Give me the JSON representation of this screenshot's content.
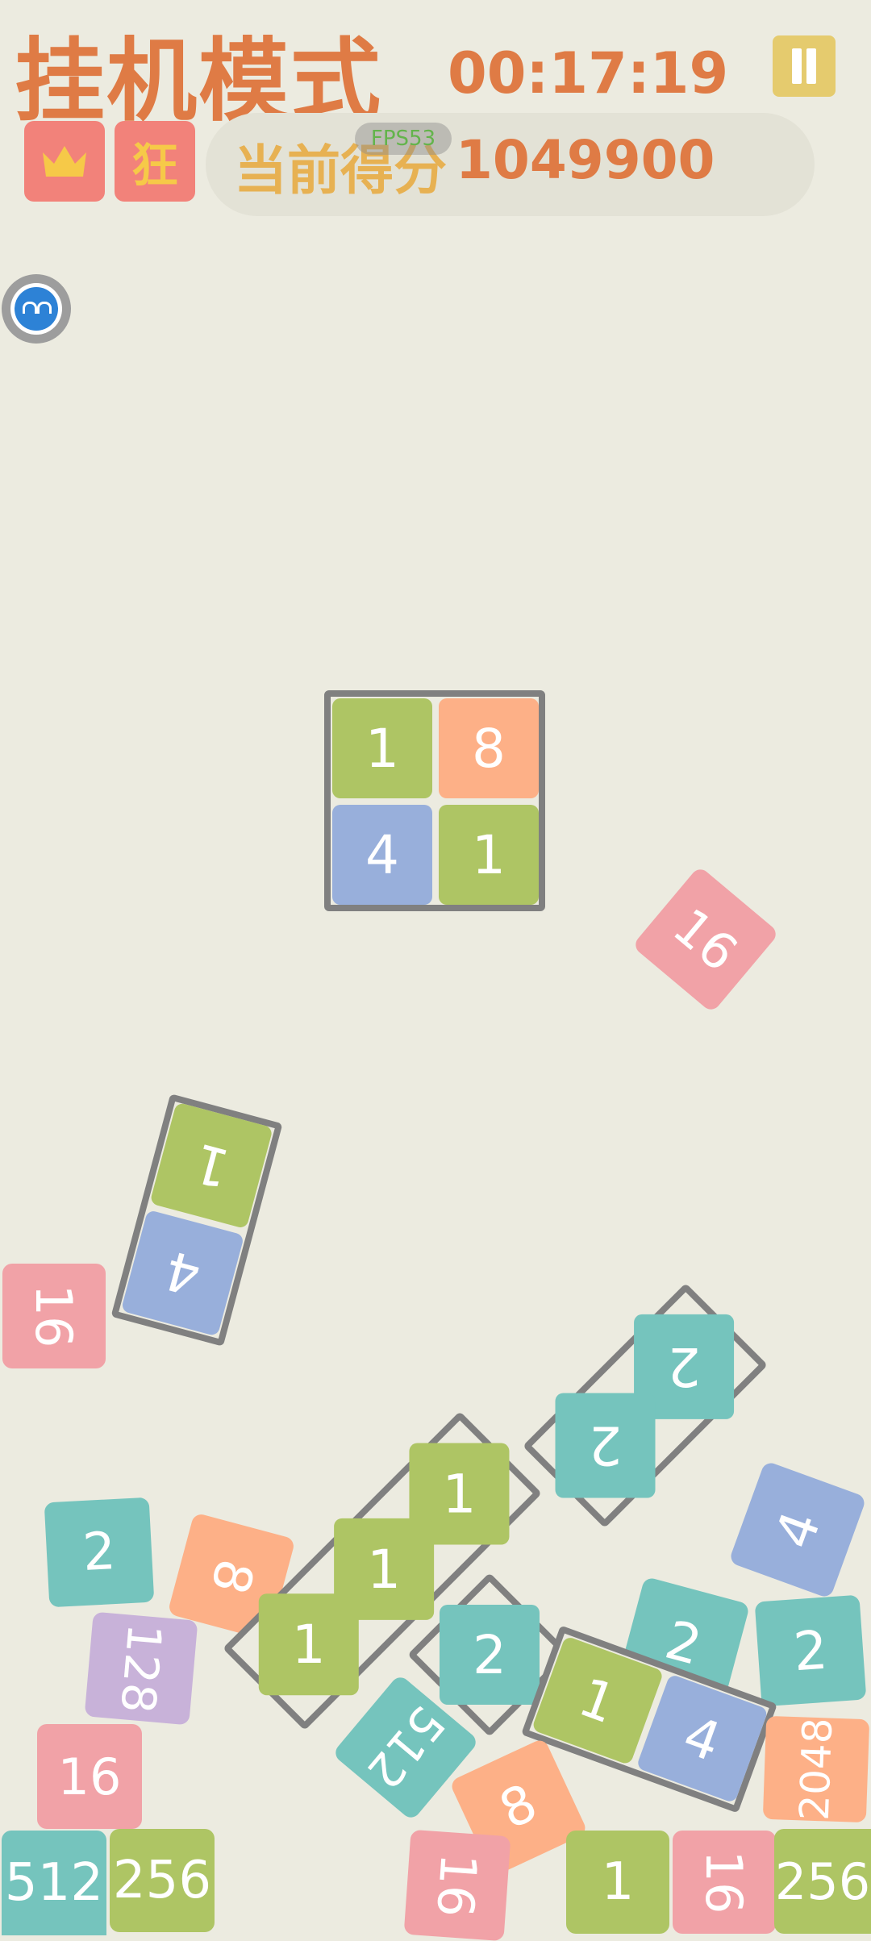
{
  "header": {
    "mode_title": "挂机模式",
    "timer": "00:17:19",
    "pause_icon": "pause-icon",
    "crown_icon": "crown-icon",
    "crazy_label": "狂",
    "score_label": "当前得分",
    "score_value": "1049900",
    "fps_label": "FPS53"
  },
  "assistant_icon": "bot-face-icon",
  "colors": {
    "background": "#ecebe0",
    "title": "#df7b45",
    "tile_1": "#aec564",
    "tile_2": "#75c4bd",
    "tile_4": "#98afdb",
    "tile_8": "#fdb087",
    "tile_16": "#f1a2a7",
    "tile_128": "#c8b2d9",
    "group_border": "#808080"
  },
  "board": {
    "falling_piece": [
      "1",
      "8",
      "4",
      "1"
    ],
    "floating_16": "16",
    "bar_top": "1",
    "bar_bottom": "4",
    "left_16": "16",
    "diag_2_a": "2",
    "diag_2_b": "2",
    "right_4": "4",
    "tile_2_left": "2",
    "tile_8_left": "8",
    "l_piece": [
      "1",
      "1",
      "1",
      "2"
    ],
    "tile_128": "128",
    "tile_512_rot": "512",
    "tile_2_mid": "2",
    "tile_2_right": "2",
    "pair_1": "1",
    "pair_4": "4",
    "tile_2048": "2048",
    "tile_16_left_low": "16",
    "tile_8_low": "8",
    "bottom_512": "512",
    "bottom_256_a": "256",
    "bottom_16_a": "16",
    "bottom_1": "1",
    "bottom_16_b": "16",
    "bottom_256_b": "256"
  }
}
